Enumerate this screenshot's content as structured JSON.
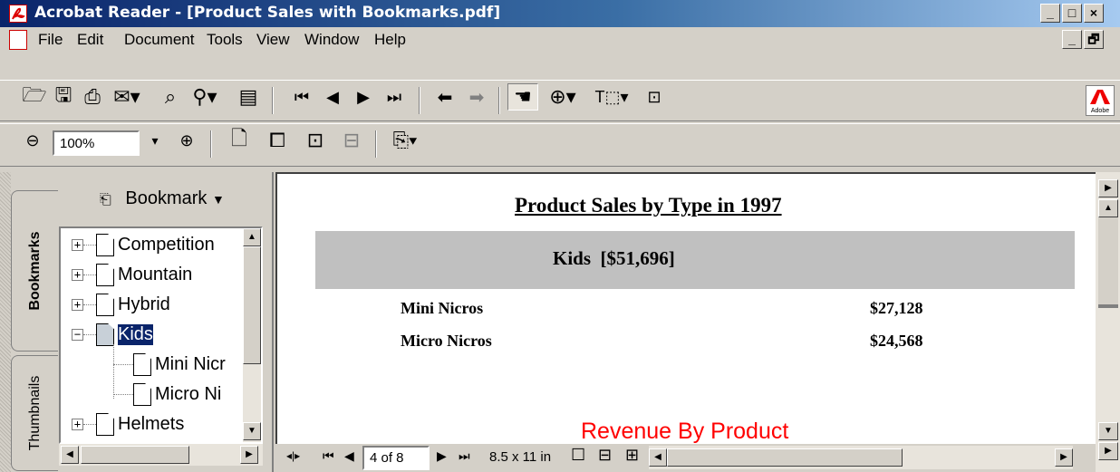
{
  "window": {
    "title": "Acrobat Reader - [Product Sales with Bookmarks.pdf]",
    "min_label": "_",
    "max_label": "□",
    "close_label": "×",
    "restore_label": "🗗"
  },
  "menu": [
    "File",
    "Edit",
    "Document",
    "Tools",
    "View",
    "Window",
    "Help"
  ],
  "zoom": {
    "value": "100%"
  },
  "nav": {
    "bookmark_menu": "Bookmark",
    "tabs": {
      "bookmarks": "Bookmarks",
      "thumbnails": "Thumbnails"
    },
    "tree": [
      {
        "label": "Competition",
        "expander": "+"
      },
      {
        "label": "Mountain",
        "expander": "+"
      },
      {
        "label": "Hybrid",
        "expander": "+"
      },
      {
        "label": "Kids",
        "expander": "−"
      },
      {
        "label": "Mini Nicr"
      },
      {
        "label": "Micro Ni"
      },
      {
        "label": "Helmets",
        "expander": "+"
      }
    ]
  },
  "document": {
    "title": "Product Sales by Type in 1997",
    "group_header": "Kids  [$51,696]",
    "rows": [
      {
        "name": "Mini Nicros",
        "amount": "$27,128"
      },
      {
        "name": "Micro Nicros",
        "amount": "$24,568"
      }
    ],
    "next_heading": "Revenue By Product"
  },
  "status": {
    "page": "4 of 8",
    "page_size": "8.5 x 11 in"
  },
  "colors": {
    "title_gradient_start": "#0a246a",
    "selection": "#0a246a",
    "red_heading": "#ff0000",
    "group_band": "#c0c0c0"
  },
  "icons": [
    "open-icon",
    "save-icon",
    "print-icon",
    "email-icon",
    "search-icon",
    "find-icon",
    "pages-icon",
    "first-page-icon",
    "prev-page-icon",
    "next-page-icon",
    "last-page-icon",
    "back-icon",
    "forward-icon",
    "hand-tool-icon",
    "zoom-tool-icon",
    "text-select-icon",
    "graphics-select-icon",
    "adobe-logo-icon"
  ]
}
